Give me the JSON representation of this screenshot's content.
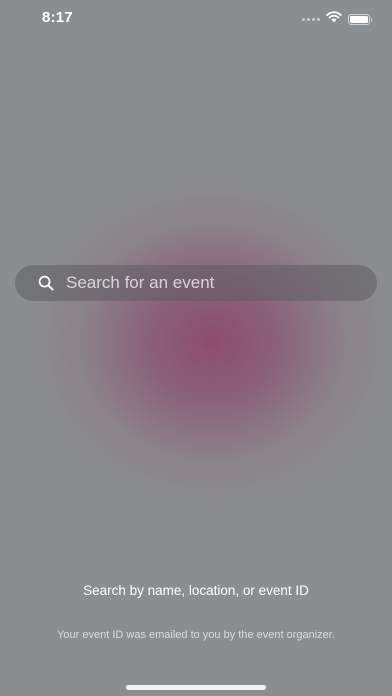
{
  "status_bar": {
    "time": "8:17",
    "icons": [
      "signal-icon",
      "wifi-icon",
      "battery-icon"
    ],
    "battery_level": 1.0
  },
  "search": {
    "placeholder": "Search for an event",
    "value": "",
    "icon": "search-icon"
  },
  "hint": {
    "title": "Search by name, location, or event ID",
    "subtitle": "Your event ID was emailed to you by the event organizer."
  },
  "colors": {
    "background": "#8b8e91",
    "glow": "#8c486c",
    "text": "#ffffff"
  }
}
